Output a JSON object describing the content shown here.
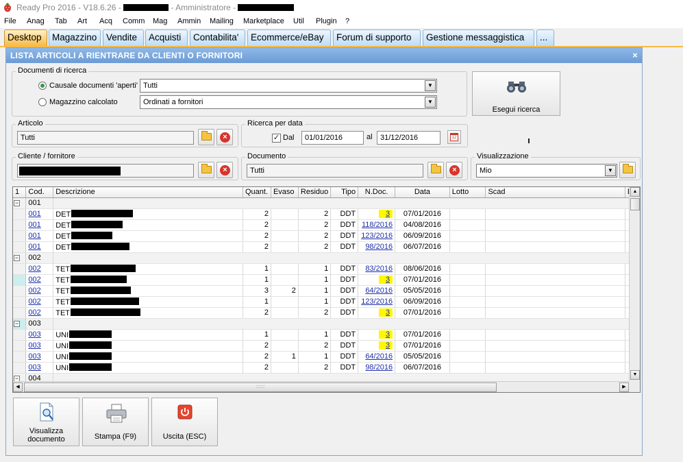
{
  "app": {
    "title": "Ready Pro 2016 - V18.6.26 -",
    "role": "- Amministratore -"
  },
  "menu": [
    "File",
    "Anag",
    "Tab",
    "Art",
    "Acq",
    "Comm",
    "Mag",
    "Ammin",
    "Mailing",
    "Marketplace",
    "Util",
    "Plugin",
    "?"
  ],
  "tabs": [
    "Desktop",
    "Magazzino",
    "Vendite",
    "Acquisti",
    "Contabilita'",
    "Ecommerce/eBay",
    "Forum di supporto",
    "Gestione messaggistica",
    "..."
  ],
  "active_tab": "Desktop",
  "window": {
    "title": "LISTA ARTICOLI A RIENTRARE DA CLIENTI O FORNITORI",
    "close": "×"
  },
  "search": {
    "group_label": "Documenti di ricerca",
    "radio1_label": "Causale documenti 'aperti'",
    "radio1_value": "Tutti",
    "radio2_label": "Magazzino calcolato",
    "radio2_value": "Ordinati a fornitori",
    "button_label": "Esegui ricerca"
  },
  "articolo": {
    "label": "Articolo",
    "value": "Tutti"
  },
  "date_search": {
    "label": "Ricerca per data",
    "dal_label": "Dal",
    "from": "01/01/2016",
    "al_label": "al",
    "to": "31/12/2016",
    "cal_glyph": "12"
  },
  "cliente": {
    "label": "Cliente / fornitore",
    "value": ""
  },
  "documento": {
    "label": "Documento",
    "value": "Tutti"
  },
  "visualizzazione": {
    "label": "Visualizzazione",
    "value": "Mio"
  },
  "grid": {
    "corner": "1",
    "headers": {
      "cod": "Cod.",
      "descr": "Descrizione",
      "quant": "Quant.",
      "evaso": "Evaso",
      "residuo": "Residuo",
      "tipo": "Tipo",
      "ndoc": "N.Doc.",
      "data": "Data",
      "lotto": "Lotto",
      "scad": "Scad",
      "extra": "De"
    },
    "rows": [
      {
        "group": "001"
      },
      {
        "cod": "001",
        "descr": "DET",
        "r": 90,
        "quant": "2",
        "evaso": "",
        "residuo": "2",
        "tipo": "DDT",
        "ndoc": "3",
        "hl": true,
        "data": "07/01/2016"
      },
      {
        "cod": "001",
        "descr": "DET",
        "r": 75,
        "quant": "2",
        "evaso": "",
        "residuo": "2",
        "tipo": "DDT",
        "ndoc": "118/2016",
        "hl": false,
        "data": "04/08/2016"
      },
      {
        "cod": "001",
        "descr": "DET",
        "r": 60,
        "quant": "2",
        "evaso": "",
        "residuo": "2",
        "tipo": "DDT",
        "ndoc": "123/2016",
        "hl": false,
        "data": "06/09/2016"
      },
      {
        "cod": "001",
        "descr": "DET",
        "r": 85,
        "quant": "2",
        "evaso": "",
        "residuo": "2",
        "tipo": "DDT",
        "ndoc": "98/2016",
        "hl": false,
        "data": "06/07/2016"
      },
      {
        "group": "002"
      },
      {
        "cod": "002",
        "descr": "TET",
        "r": 95,
        "quant": "1",
        "evaso": "",
        "residuo": "1",
        "tipo": "DDT",
        "ndoc": "83/2016",
        "hl": false,
        "data": "08/06/2016"
      },
      {
        "cod": "002",
        "descr": "TET",
        "r": 82,
        "quant": "1",
        "evaso": "",
        "residuo": "1",
        "tipo": "DDT",
        "ndoc": "3",
        "hl": true,
        "data": "07/01/2016",
        "mark": true
      },
      {
        "cod": "002",
        "descr": "TET",
        "r": 88,
        "quant": "3",
        "evaso": "2",
        "residuo": "1",
        "tipo": "DDT",
        "ndoc": "64/2016",
        "hl": false,
        "data": "05/05/2016"
      },
      {
        "cod": "002",
        "descr": "TET",
        "r": 100,
        "quant": "1",
        "evaso": "",
        "residuo": "1",
        "tipo": "DDT",
        "ndoc": "123/2016",
        "hl": false,
        "data": "06/09/2016"
      },
      {
        "cod": "002",
        "descr": "TET",
        "r": 102,
        "quant": "2",
        "evaso": "",
        "residuo": "2",
        "tipo": "DDT",
        "ndoc": "3",
        "hl": true,
        "data": "07/01/2016"
      },
      {
        "group": "003",
        "mark": true
      },
      {
        "cod": "003",
        "descr": "UNI",
        "r": 62,
        "quant": "1",
        "evaso": "",
        "residuo": "1",
        "tipo": "DDT",
        "ndoc": "3",
        "hl": true,
        "data": "07/01/2016"
      },
      {
        "cod": "003",
        "descr": "UNI",
        "r": 62,
        "quant": "2",
        "evaso": "",
        "residuo": "2",
        "tipo": "DDT",
        "ndoc": "3",
        "hl": true,
        "data": "07/01/2016"
      },
      {
        "cod": "003",
        "descr": "UNI",
        "r": 62,
        "quant": "2",
        "evaso": "1",
        "residuo": "1",
        "tipo": "DDT",
        "ndoc": "64/2016",
        "hl": false,
        "data": "05/05/2016"
      },
      {
        "cod": "003",
        "descr": "UNI",
        "r": 62,
        "quant": "2",
        "evaso": "",
        "residuo": "2",
        "tipo": "DDT",
        "ndoc": "98/2016",
        "hl": false,
        "data": "06/07/2016"
      },
      {
        "group": "004"
      }
    ]
  },
  "buttons": {
    "view": "Visualizza documento",
    "print": "Stampa (F9)",
    "exit": "Uscita (ESC)"
  },
  "colors": {
    "active_tab": "#f7b944",
    "tab": "#bcdcf6",
    "window_title": "#7aa7dc",
    "highlight": "#fef700",
    "link": "#1c2ea8"
  }
}
